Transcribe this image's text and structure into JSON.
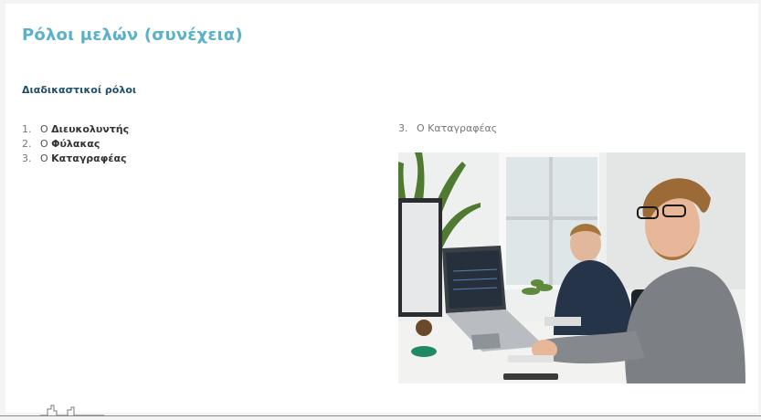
{
  "slide": {
    "title": "Ρόλοι μελών (συνέχεια)",
    "subtitle": "Διαδικαστικοί ρόλοι",
    "items": [
      {
        "num": "1.",
        "prefix": "Ο ",
        "bold": "Διευκολυντής"
      },
      {
        "num": "2.",
        "prefix": "Ο ",
        "bold": "Φύλακας"
      },
      {
        "num": "3.",
        "prefix": "Ο ",
        "bold": "Καταγραφέας"
      }
    ],
    "right": {
      "num": "3.",
      "text": "Ο Καταγραφέας"
    }
  },
  "photo": {
    "icon": "office-photo"
  },
  "footer": {
    "logo_icon": "city-skyline-icon"
  }
}
